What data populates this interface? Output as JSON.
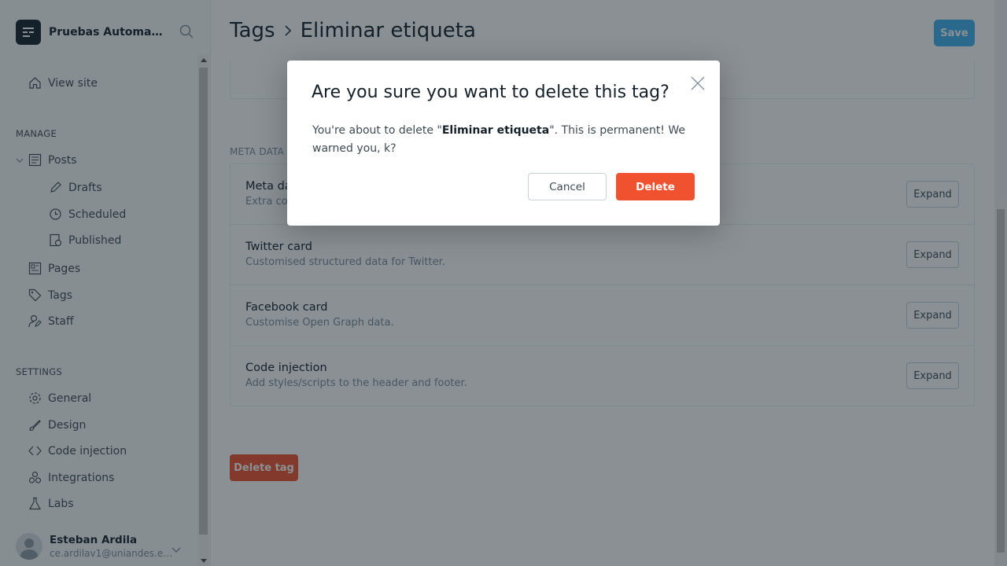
{
  "sidebar": {
    "brand_name": "Pruebas Automati...",
    "view_site": "View site",
    "manage_label": "MANAGE",
    "posts": "Posts",
    "drafts": "Drafts",
    "scheduled": "Scheduled",
    "published": "Published",
    "pages": "Pages",
    "tags": "Tags",
    "staff": "Staff",
    "settings_label": "SETTINGS",
    "general": "General",
    "design": "Design",
    "code_injection": "Code injection",
    "integrations": "Integrations",
    "labs": "Labs",
    "user_name": "Esteban Ardila",
    "user_email": "ce.ardilav1@uniandes.edu..."
  },
  "header": {
    "crumb_parent": "Tags",
    "crumb_current": "Eliminar etiqueta",
    "save_label": "Save"
  },
  "meta": {
    "section_label": "META DATA",
    "rows": [
      {
        "title": "Meta data",
        "desc": "Extra content for search engines.",
        "button": "Expand"
      },
      {
        "title": "Twitter card",
        "desc": "Customised structured data for Twitter.",
        "button": "Expand"
      },
      {
        "title": "Facebook card",
        "desc": "Customise Open Graph data.",
        "button": "Expand"
      },
      {
        "title": "Code injection",
        "desc": "Add styles/scripts to the header and footer.",
        "button": "Expand"
      }
    ]
  },
  "delete_tag_label": "Delete tag",
  "modal": {
    "title": "Are you sure you want to delete this tag?",
    "body_prefix": "You're about to delete \"",
    "tag_name": "Eliminar etiqueta",
    "body_suffix": "\". This is permanent! We warned you, k?",
    "cancel_label": "Cancel",
    "delete_label": "Delete"
  },
  "colors": {
    "accent": "#3eb0ef",
    "danger": "#f05230",
    "text": "#15212a"
  }
}
